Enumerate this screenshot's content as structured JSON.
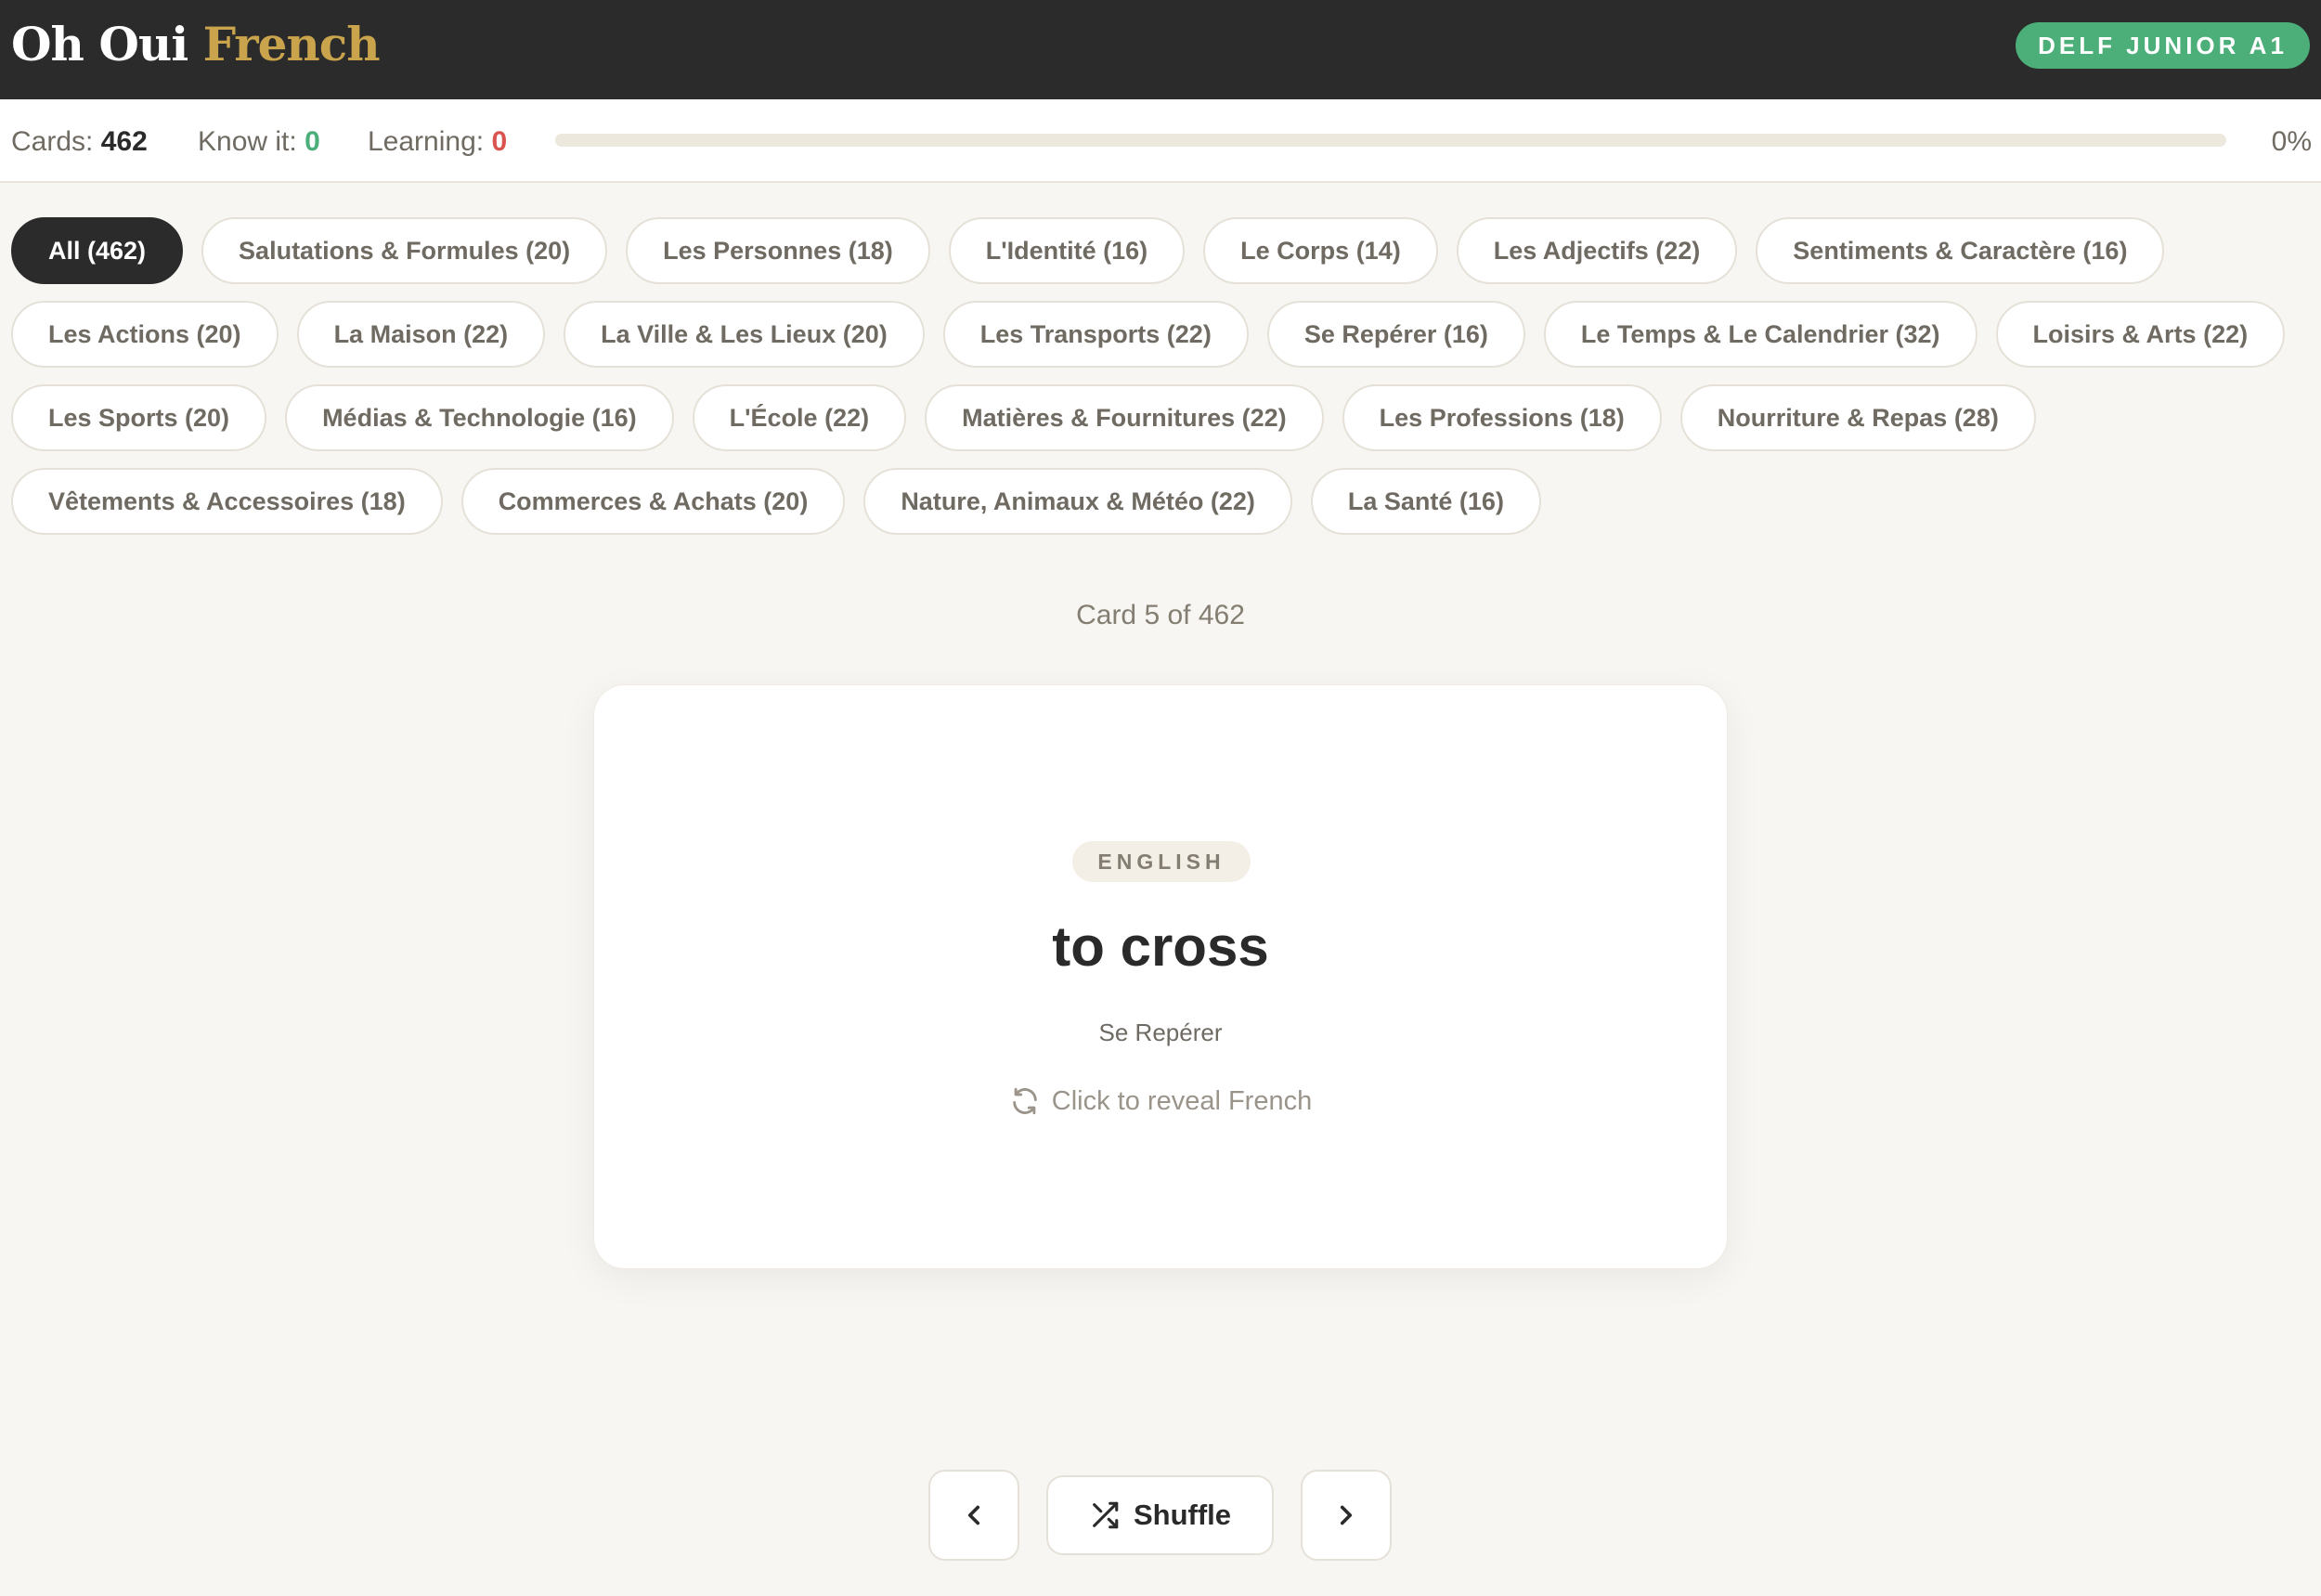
{
  "header": {
    "logo_word1": "Oh Oui",
    "logo_word2": "French",
    "level_badge": "DELF JUNIOR A1"
  },
  "stats": {
    "cards_label": "Cards:",
    "cards_value": "462",
    "know_label": "Know it:",
    "know_value": "0",
    "learning_label": "Learning:",
    "learning_value": "0",
    "progress_fraction": 0,
    "progress_text": "0%"
  },
  "categories": [
    {
      "label": "All (462)",
      "active": true
    },
    {
      "label": "Salutations & Formules (20)"
    },
    {
      "label": "Les Personnes (18)"
    },
    {
      "label": "L'Identité (16)"
    },
    {
      "label": "Le Corps (14)"
    },
    {
      "label": "Les Adjectifs (22)"
    },
    {
      "label": "Sentiments & Caractère (16)"
    },
    {
      "label": "Les Actions (20)"
    },
    {
      "label": "La Maison (22)"
    },
    {
      "label": "La Ville & Les Lieux (20)"
    },
    {
      "label": "Les Transports (22)"
    },
    {
      "label": "Se Repérer (16)"
    },
    {
      "label": "Le Temps & Le Calendrier (32)"
    },
    {
      "label": "Loisirs & Arts (22)"
    },
    {
      "label": "Les Sports (20)"
    },
    {
      "label": "Médias & Technologie (16)"
    },
    {
      "label": "L'École (22)"
    },
    {
      "label": "Matières & Fournitures (22)"
    },
    {
      "label": "Les Professions (18)"
    },
    {
      "label": "Nourriture & Repas (28)"
    },
    {
      "label": "Vêtements & Accessoires (18)"
    },
    {
      "label": "Commerces & Achats (20)"
    },
    {
      "label": "Nature, Animaux & Météo (22)"
    },
    {
      "label": "La Santé (16)"
    }
  ],
  "counter": "Card 5 of 462",
  "card": {
    "language_tag": "ENGLISH",
    "word": "to cross",
    "category": "Se Repérer",
    "hint": "Click to reveal French",
    "hint_icon": "refresh-icon"
  },
  "controls": {
    "prev_icon": "chevron-left-icon",
    "shuffle_icon": "shuffle-icon",
    "shuffle_label": "Shuffle",
    "next_icon": "chevron-right-icon"
  },
  "colors": {
    "accent_green": "#4caf7a",
    "logo_gold": "#c9a44c",
    "learning_red": "#d9534f",
    "header_dark": "#2b2b2b",
    "page_bg": "#f8f6f2"
  }
}
